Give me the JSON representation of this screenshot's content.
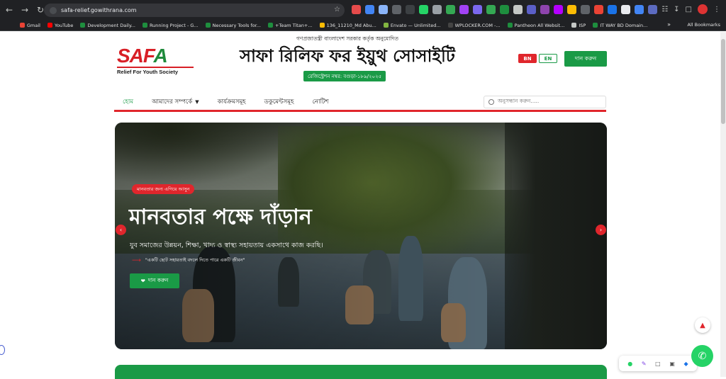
{
  "browser": {
    "url": "safa-relief.gowithrana.com",
    "bookmarks": [
      {
        "label": "Gmail",
        "color": "#ea4335"
      },
      {
        "label": "YouTube",
        "color": "#ff0000"
      },
      {
        "label": "Development Daily...",
        "color": "#1e8e3e"
      },
      {
        "label": "Running Project - G...",
        "color": "#1e8e3e"
      },
      {
        "label": "Necessary Tools for...",
        "color": "#1e8e3e"
      },
      {
        "label": "+Team Titan+...",
        "color": "#1e8e3e"
      },
      {
        "label": "136_11210_Md Abu...",
        "color": "#fbbc04"
      },
      {
        "label": "Envato — Unlimited...",
        "color": "#82b541"
      },
      {
        "label": "WPLOCKER.COM -...",
        "color": "#444"
      },
      {
        "label": "Pantheon All Websit...",
        "color": "#1e8e3e"
      },
      {
        "label": "ISP",
        "color": "#c4c7c5"
      },
      {
        "label": "IT WAY BD Domain...",
        "color": "#1e8e3e"
      }
    ],
    "all_bookmarks": "All Bookmarks"
  },
  "header": {
    "logo_word_red": "SAF",
    "logo_word_green": "A",
    "logo_tagline": "Relief For Youth Society",
    "approval": "গণপ্রজাতন্ত্রী বাংলাদেশ সরকার কর্তৃক অনুমোদিত",
    "title": "সাফা রিলিফ ফর ইয়ুথ সোসাইটি",
    "registration": "রেজিস্ট্রেশন নম্বর: বগুড়া-১৮৯/২০২৫",
    "lang_bn": "BN",
    "lang_en": "EN",
    "donate": "দান করুন"
  },
  "nav": {
    "items": [
      "হোম",
      "আমাদের সম্পর্কে",
      "কার্যক্রমসমূহ",
      "ডকুমেন্টসমূহ",
      "নোটিশ"
    ],
    "search_placeholder": "অনুসন্ধান করুন....."
  },
  "hero": {
    "badge": "মানবতার জন্য এগিয়ে আসুন",
    "title": "মানবতার পক্ষে দাঁড়ান",
    "subtitle": "যুব সমাজের উন্নয়ন, শিক্ষা, খাদ্য ও স্বাস্থ্য সহায়তায় একসাথে কাজ করছি।",
    "quote": "\"একটি ছোট সহায়তাই বদলে দিতে পারে একটি জীবন\"",
    "donate": "দান করুন"
  },
  "colors": {
    "brand_green": "#1a9a46",
    "brand_red": "#e0262c"
  }
}
